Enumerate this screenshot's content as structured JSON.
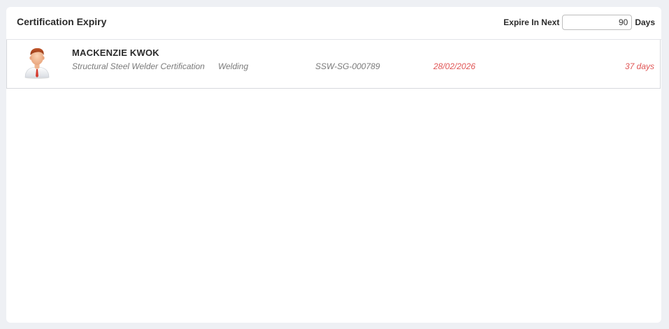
{
  "header": {
    "title": "Certification Expiry",
    "expire_label": "Expire In Next",
    "expire_value": "90",
    "days_label": "Days"
  },
  "records": [
    {
      "name": "MACKENZIE KWOK",
      "certification": "Structural Steel Welder Certification",
      "category": "Welding",
      "cert_number": "SSW-SG-000789",
      "expiry_date": "28/02/2026",
      "days_remaining": "37 days",
      "avatar_icon": "male-user-avatar-icon"
    }
  ],
  "colors": {
    "page_background": "#eef0f4",
    "panel_background": "#ffffff",
    "alert_red": "#e05555",
    "muted_text": "#7a7a7a"
  }
}
